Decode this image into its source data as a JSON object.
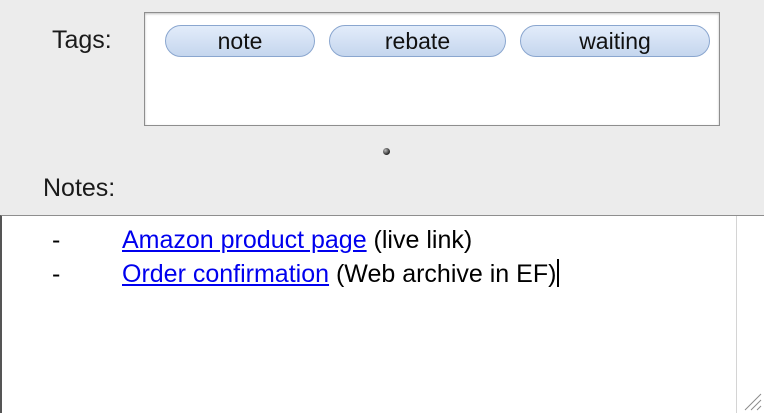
{
  "tags": {
    "label": "Tags:",
    "items": [
      "note",
      "rebate",
      "waiting"
    ]
  },
  "notes": {
    "label": "Notes:",
    "lines": [
      {
        "bullet": "-",
        "link_text": "Amazon product page",
        "suffix": " (live link)"
      },
      {
        "bullet": "-",
        "link_text": "Order confirmation",
        "suffix": " (Web archive in EF)"
      }
    ]
  },
  "colors": {
    "panel_bg": "#ececec",
    "link": "#0000ee",
    "tag_fill": "#c5d6ee",
    "tag_border": "#8aa6cf"
  },
  "icons": {
    "splitter": "splitter-dot-icon",
    "resize": "resize-grip-icon"
  }
}
